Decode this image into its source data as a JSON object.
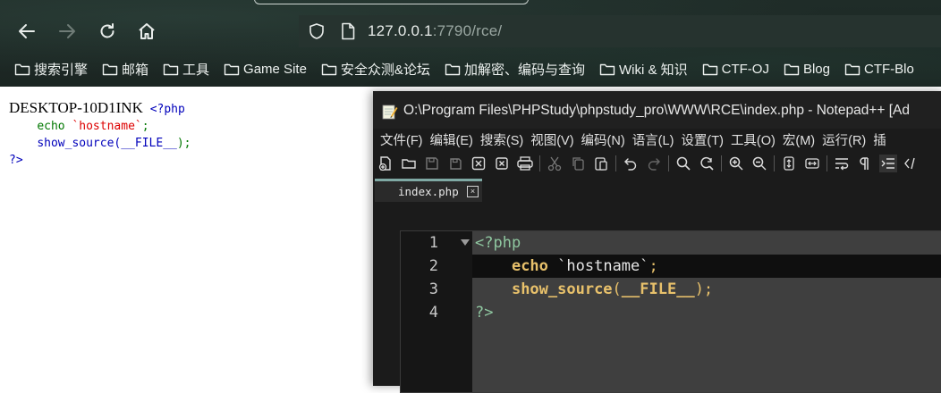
{
  "browser": {
    "url_host": "127.0.0.1",
    "url_rest": ":7790/rce/",
    "bookmarks": [
      {
        "label": "搜索引擎"
      },
      {
        "label": "邮箱"
      },
      {
        "label": "工具"
      },
      {
        "label": "Game Site"
      },
      {
        "label": "安全众测&论坛"
      },
      {
        "label": "加解密、编码与查询"
      },
      {
        "label": "Wiki & 知识"
      },
      {
        "label": "CTF-OJ"
      },
      {
        "label": "Blog"
      },
      {
        "label": "CTF-Blo"
      }
    ]
  },
  "page": {
    "hostname_output": "DESKTOP-10D1INK",
    "source": {
      "open_tag": "<?php",
      "line2_kw": "echo",
      "line2_str": "`hostname`",
      "line2_end": ";",
      "line3_fn": "show_source(",
      "line3_const": "__FILE__",
      "line3_end": ");",
      "close_tag": "?>"
    }
  },
  "notepad": {
    "title": "O:\\Program Files\\PHPStudy\\phpstudy_pro\\WWW\\RCE\\index.php - Notepad++ [Ad",
    "menu": [
      "文件(F)",
      "编辑(E)",
      "搜索(S)",
      "视图(V)",
      "编码(N)",
      "语言(L)",
      "设置(T)",
      "工具(O)",
      "宏(M)",
      "运行(R)",
      "插"
    ],
    "tab_label": "index.php",
    "tab_close": "×",
    "line_numbers": [
      "1",
      "2",
      "3",
      "4"
    ],
    "code": {
      "l1": "<?php",
      "l2_kw": "echo",
      "l2_str": "`hostname`",
      "l2_end": ";",
      "l3_fn": "show_source",
      "l3_paren_open": "(",
      "l3_const": "__FILE__",
      "l3_end": ");",
      "l4": "?>"
    }
  }
}
